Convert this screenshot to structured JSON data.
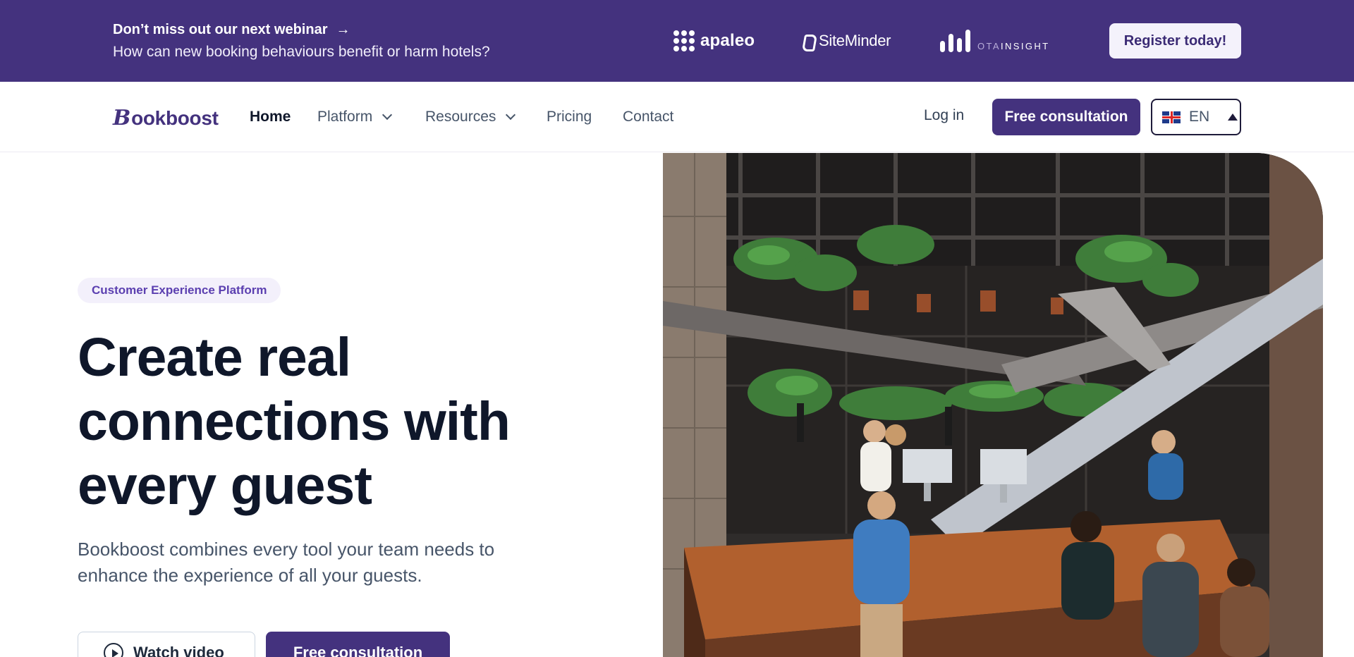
{
  "banner": {
    "title": "Don’t miss out our next webinar",
    "subtitle": "How can new booking behaviours benefit or harm hotels?",
    "partners": {
      "apaleo": "apaleo",
      "siteminder": "SiteMinder",
      "ota_light": "OTA",
      "ota_bold": "INSIGHT"
    },
    "register_label": "Register today!"
  },
  "nav": {
    "logo": "ookboost",
    "logo_initial": "B",
    "items": [
      {
        "label": "Home"
      },
      {
        "label": "Platform"
      },
      {
        "label": "Resources"
      },
      {
        "label": "Pricing"
      },
      {
        "label": "Contact"
      }
    ],
    "login_label": "Log in",
    "consult_label": "Free consultation",
    "language": "EN"
  },
  "hero": {
    "badge": "Customer Experience Platform",
    "title": "Create real connections with every guest",
    "description": "Bookboost combines every tool your team needs to enhance the experience of all your guests.",
    "watch_label": "Watch video",
    "consult_label": "Free consultation"
  },
  "colors": {
    "brand": "#44327e",
    "banner_bg": "#44327e",
    "badge_text": "#5b3fb0",
    "heading": "#0f172a",
    "body_text": "#475569"
  },
  "icons": {
    "banner_arrow": "arrow-right-icon",
    "platform_dropdown": "chevron-down-icon",
    "resources_dropdown": "chevron-down-icon",
    "language_flag": "uk-flag-icon",
    "language_toggle": "caret-up-icon",
    "watch_video": "play-circle-icon"
  }
}
